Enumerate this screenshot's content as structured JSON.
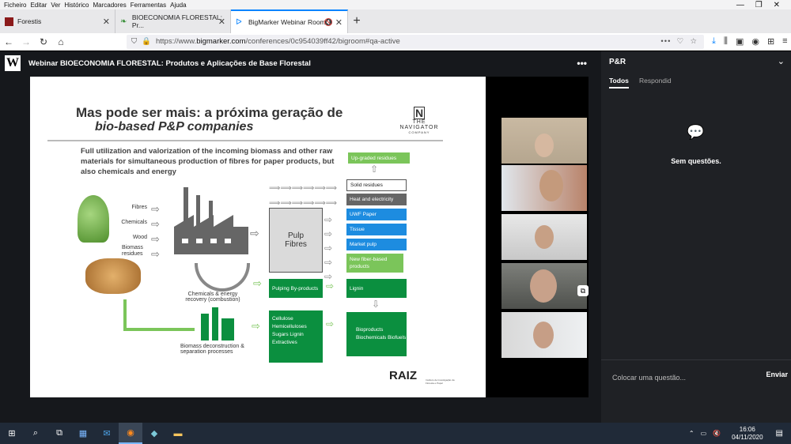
{
  "menubar": [
    "Ficheiro",
    "Editar",
    "Ver",
    "Histórico",
    "Marcadores",
    "Ferramentas",
    "Ajuda"
  ],
  "tabs": [
    {
      "label": "Forestis"
    },
    {
      "label": "BIOECONOMIA FLORESTAL: Pr..."
    },
    {
      "label": "BigMarker Webinar Room"
    }
  ],
  "url": {
    "prefix": "https://www.",
    "domain": "bigmarker.com",
    "rest": "/conferences/0c954039ff42/bigroom#qa-active"
  },
  "webinar": {
    "title": "Webinar BIOECONOMIA FLORESTAL: Produtos e Aplicações de Base Florestal",
    "logo": "W"
  },
  "slide": {
    "title1": "Mas pode ser mais: a próxima geração de",
    "title2": "bio-based P&P companies",
    "logo_main": "N",
    "logo_sub": "THE NAVIGATOR",
    "logo_sub2": "COMPANY",
    "intro": "Full utilization and valorization of the incoming biomass and other raw materials for simultaneous production of fibres for paper products, but also chemicals and energy",
    "inputs": [
      "Fibres",
      "Chemicals",
      "Wood",
      "Biomass residues"
    ],
    "pulp": "Pulp Fibres",
    "recovery": "Chemicals & energy recovery (combustion)",
    "deconstruction": "Biomass deconstruction & separation processes",
    "pulping": "Pulping By-products",
    "cellulose": "Cellulose Hemicelluloses Sugars Lignin Extractives",
    "outputs": {
      "upgraded": "Up-graded residues",
      "solid": "Solid residues",
      "heat": "Heat and electricity",
      "uwf": "UWF Paper",
      "tissue": "Tissue",
      "market": "Market pulp",
      "newfiber": "New fiber-based products",
      "lignin": "Lignin",
      "bio": "Bioproducts Biochemicals Biofuels"
    },
    "raiz": "RAIZ",
    "raiz_sub": "Instituto de Investigação da Floresta e Papel"
  },
  "panel": {
    "title": "P&R",
    "tabs": [
      "Todos",
      "Respondid"
    ],
    "empty": "Sem questões.",
    "placeholder": "Colocar uma questão...",
    "send": "Enviar"
  },
  "clock": {
    "time": "16:06",
    "date": "04/11/2020"
  },
  "colors": {
    "accent": "#0a84ff",
    "taskbar": "#202a38",
    "panel": "#1f2125"
  }
}
